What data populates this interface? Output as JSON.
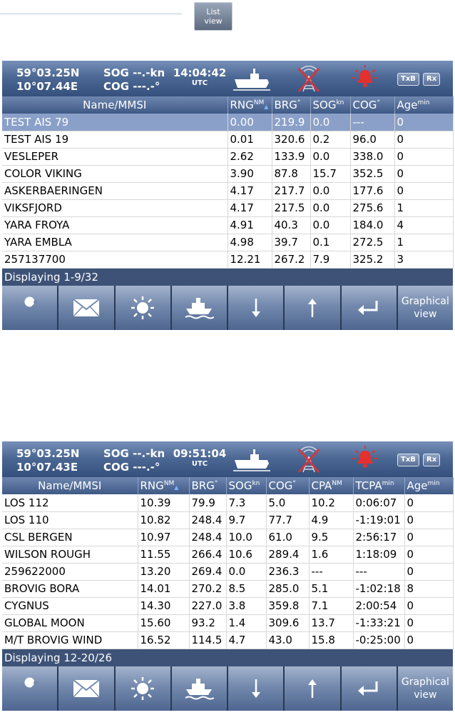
{
  "list_view_button": {
    "line1": "List",
    "line2": "view"
  },
  "panels": [
    {
      "header": {
        "lat": "59°03.25N",
        "lon": "10°07.44E",
        "sog": "SOG --.-kn",
        "cog": "COG ---.-°",
        "time": "14:04:42",
        "time_unit": "UTC",
        "txb": "TxB",
        "rx": "Rx"
      },
      "columns": [
        "Name/MMSI",
        "RNG",
        "BRG",
        "SOG",
        "COG",
        "Age"
      ],
      "column_units": [
        "",
        "NM",
        "°",
        "kn",
        "°",
        "min"
      ],
      "rows": [
        [
          "TEST AIS 79",
          "0.00",
          "219.9",
          "0.0",
          "---",
          "0"
        ],
        [
          "TEST AIS 19",
          "0.01",
          "320.6",
          "0.2",
          "96.0",
          "0"
        ],
        [
          "VESLEPER",
          "2.62",
          "133.9",
          "0.0",
          "338.0",
          "0"
        ],
        [
          "COLOR VIKING",
          "3.90",
          "87.8",
          "15.7",
          "352.5",
          "0"
        ],
        [
          " ASKERBAERINGEN",
          "4.17",
          "217.7",
          "0.0",
          "177.6",
          "0"
        ],
        [
          "VIKSFJORD",
          "4.17",
          "217.5",
          "0.0",
          "275.6",
          "1"
        ],
        [
          "YARA FROYA",
          "4.91",
          "40.3",
          "0.0",
          "184.0",
          "4"
        ],
        [
          "YARA EMBLA",
          "4.98",
          "39.7",
          "0.1",
          "272.5",
          "1"
        ],
        [
          "257137700",
          "12.21",
          "267.2",
          "7.9",
          "325.2",
          "3"
        ]
      ],
      "status": "Displaying 1-9/32",
      "graphical_view": {
        "line1": "Graphical",
        "line2": "view"
      }
    },
    {
      "header": {
        "lat": "59°03.25N",
        "lon": "10°07.43E",
        "sog": "SOG --.-kn",
        "cog": "COG ---.-°",
        "time": "09:51:04",
        "time_unit": "UTC",
        "txb": "TxB",
        "rx": "Rx"
      },
      "columns": [
        "Name/MMSI",
        "RNG",
        "BRG",
        "SOG",
        "COG",
        "CPA",
        "TCPA",
        "Age"
      ],
      "column_units": [
        "",
        "NM",
        "°",
        "kn",
        "°",
        "NM",
        "min",
        "min"
      ],
      "rows": [
        [
          "LOS 112",
          "10.39",
          "79.9",
          "7.3",
          "5.0",
          "10.2",
          "0:06:07",
          "0"
        ],
        [
          "LOS 110",
          "10.82",
          "248.4",
          "9.7",
          "77.7",
          "4.9",
          "-1:19:01",
          "0"
        ],
        [
          "CSL BERGEN",
          "10.97",
          "248.4",
          "10.0",
          "61.0",
          "9.5",
          "2:56:17",
          "0"
        ],
        [
          "WILSON ROUGH",
          "11.55",
          "266.4",
          "10.6",
          "289.4",
          "1.6",
          "1:18:09",
          "0"
        ],
        [
          "259622000",
          "13.20",
          "269.4",
          "0.0",
          "236.3",
          "---",
          "---",
          "0"
        ],
        [
          "BROVIG BORA",
          "14.01",
          "270.2",
          "8.5",
          "285.0",
          "5.1",
          "-1:02:18",
          "8"
        ],
        [
          "CYGNUS",
          "14.30",
          "227.0",
          "3.8",
          "359.8",
          "7.1",
          "2:00:54",
          "0"
        ],
        [
          "GLOBAL MOON",
          "15.60",
          "93.2",
          "1.4",
          "309.6",
          "13.7",
          "-1:33:21",
          "0"
        ],
        [
          "M/T BROVIG WIND",
          "16.52",
          "114.5",
          "4.7",
          "43.0",
          "15.8",
          "-0:25:00",
          "0"
        ]
      ],
      "status": "Displaying 12-20/26",
      "graphical_view": {
        "line1": "Graphical",
        "line2": "view"
      }
    }
  ],
  "buttons": [
    "wrench-icon",
    "envelope-icon",
    "sun-icon",
    "ship-icon",
    "arrow-down-icon",
    "arrow-up-icon",
    "enter-icon"
  ],
  "colors": {
    "header": "#4c6894",
    "selected_row": "#8aa0c8",
    "alarm": "#e53030"
  }
}
